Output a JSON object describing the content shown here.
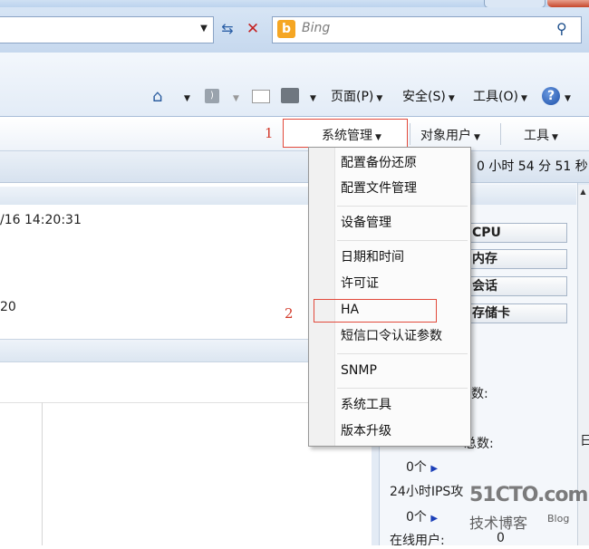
{
  "browser": {
    "search_placeholder": "Bing",
    "refresh_glyph": "⇆",
    "stop_glyph": "✕",
    "command_bar": {
      "page_label": "页面(P)",
      "safety_label": "安全(S)",
      "tools_label": "工具(O)"
    }
  },
  "app_menu": {
    "annotation_1": "1",
    "system_management": "系统管理",
    "object_users": "对象用户",
    "tools": "工具"
  },
  "status": {
    "uptime": "0 小时 54 分 51 秒"
  },
  "main": {
    "datetime": "/16 14:20:31",
    "value_20": "20"
  },
  "right_panel": {
    "buttons": [
      "CPU",
      "内存",
      "会话",
      "存储卡"
    ],
    "label_count": "数:",
    "label_total": "总数:",
    "edge_char": "日",
    "count_a": "0个",
    "ips_24h": "24小时IPS攻",
    "count_b": "0个",
    "online_users_label": "在线用户:",
    "online_users_value": "0"
  },
  "dropdown": {
    "annotation_2": "2",
    "items": [
      "配置备份还原",
      "配置文件管理",
      "设备管理",
      "日期和时间",
      "许可证",
      "HA",
      "短信口令认证参数",
      "SNMP",
      "系统工具",
      "版本升级"
    ]
  },
  "watermark": {
    "main": "51CTO.com",
    "sub": "技术博客",
    "blog": "Blog"
  },
  "icons": {
    "home": "home-icon",
    "rss": "rss-icon",
    "mail": "mail-icon",
    "print": "print-icon",
    "help": "help-icon",
    "search": "search-icon",
    "bing": "bing-logo-icon"
  }
}
